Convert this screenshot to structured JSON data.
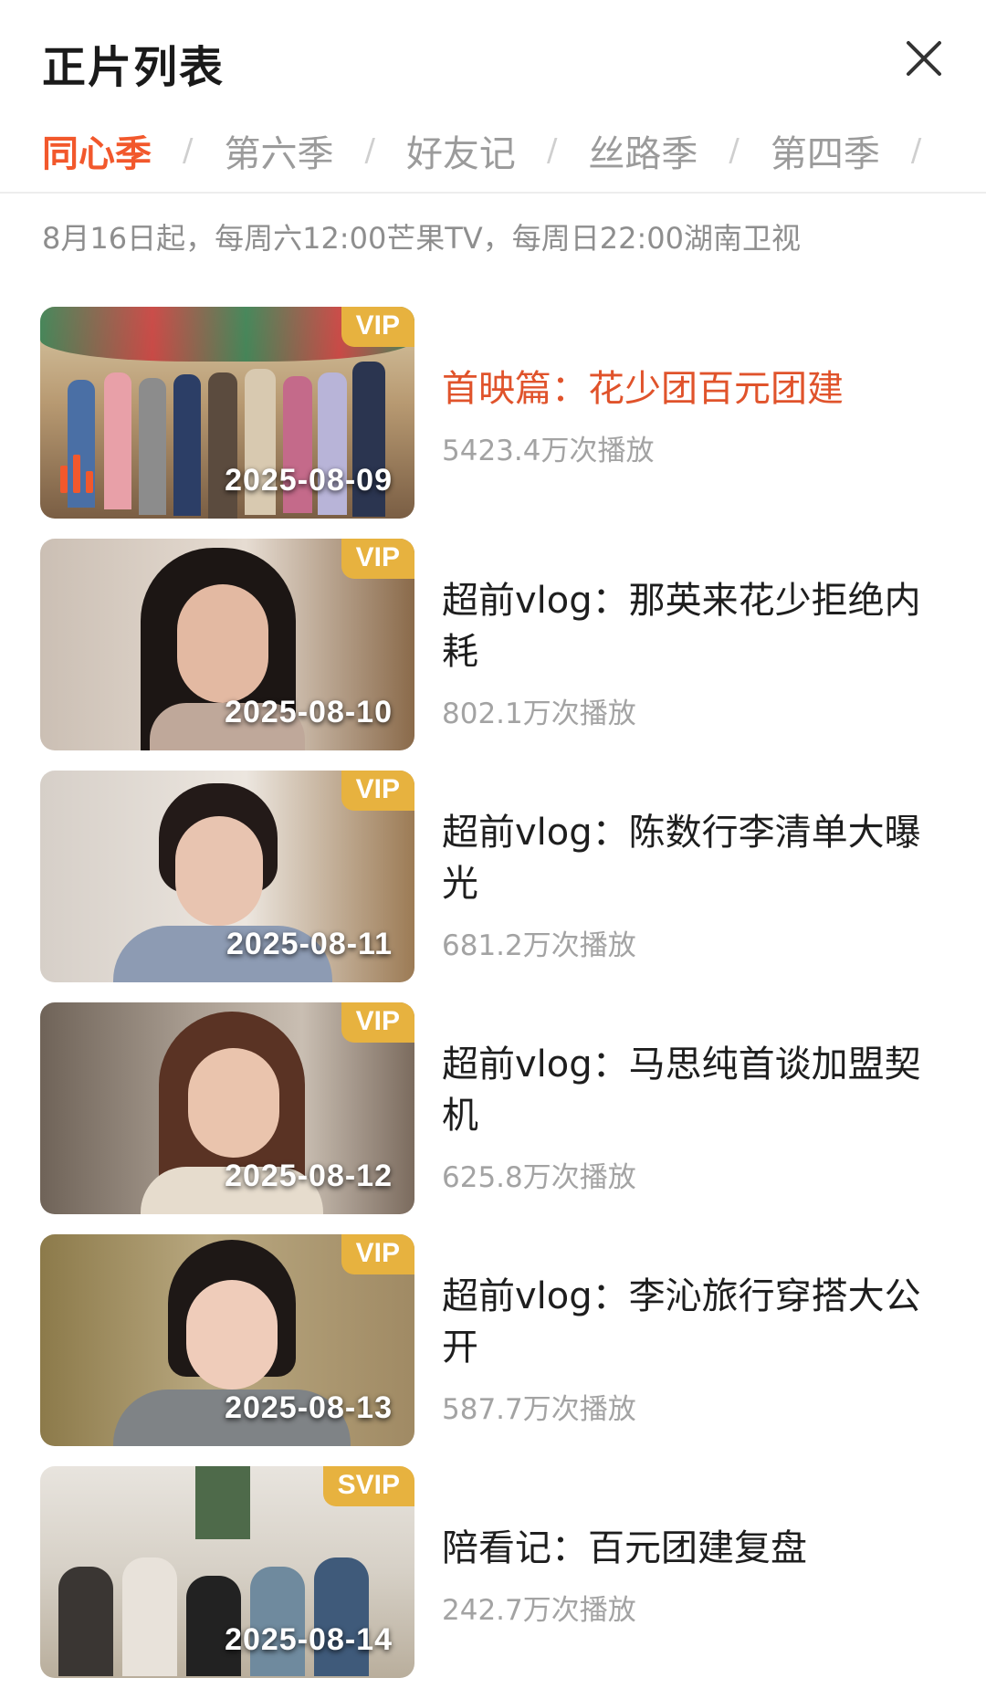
{
  "header": {
    "title": "正片列表",
    "close_icon": "close-icon"
  },
  "tabs": [
    {
      "label": "同心季",
      "active": true
    },
    {
      "label": "第六季",
      "active": false
    },
    {
      "label": "好友记",
      "active": false
    },
    {
      "label": "丝路季",
      "active": false
    },
    {
      "label": "第四季",
      "active": false
    }
  ],
  "tab_separator": "/",
  "schedule": "8月16日起，每周六12:00芒果TV，每周日22:00湖南卫视",
  "episodes": [
    {
      "badge": "VIP",
      "date": "2025-08-09",
      "title": "首映篇：花少团百元团建",
      "views": "5423.4万次播放",
      "playing": true
    },
    {
      "badge": "VIP",
      "date": "2025-08-10",
      "title": "超前vlog：那英来花少拒绝内耗",
      "views": "802.1万次播放",
      "playing": false
    },
    {
      "badge": "VIP",
      "date": "2025-08-11",
      "title": "超前vlog：陈数行李清单大曝光",
      "views": "681.2万次播放",
      "playing": false
    },
    {
      "badge": "VIP",
      "date": "2025-08-12",
      "title": "超前vlog：马思纯首谈加盟契机",
      "views": "625.8万次播放",
      "playing": false
    },
    {
      "badge": "VIP",
      "date": "2025-08-13",
      "title": "超前vlog：李沁旅行穿搭大公开",
      "views": "587.7万次播放",
      "playing": false
    },
    {
      "badge": "SVIP",
      "date": "2025-08-14",
      "title": "陪看记：百元团建复盘",
      "views": "242.7万次播放",
      "playing": false
    }
  ],
  "colors": {
    "accent": "#f2582c",
    "badge": "#e7b23f",
    "muted": "#9b9b9b"
  }
}
